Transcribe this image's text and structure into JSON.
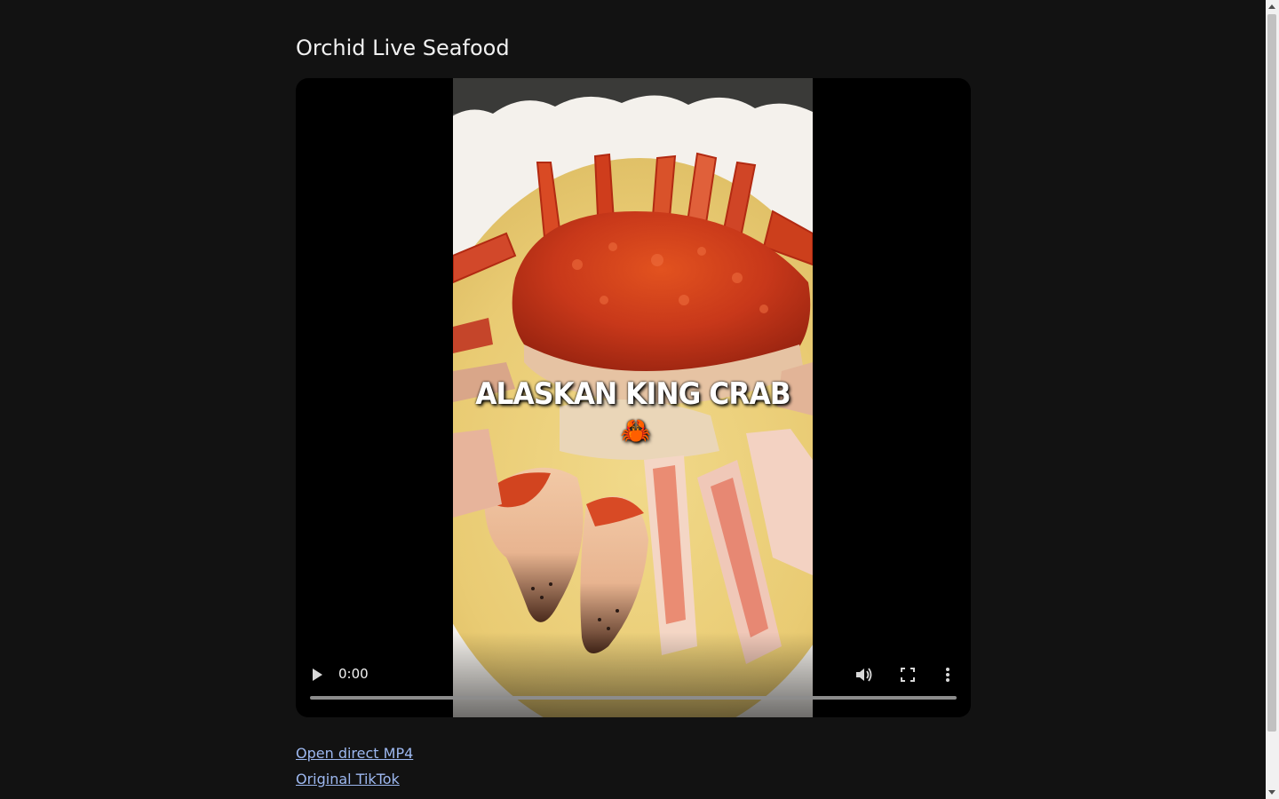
{
  "page": {
    "title": "Orchid Live Seafood"
  },
  "video": {
    "overlay_caption": "ALASKAN KING CRAB",
    "overlay_emoji": "🦀",
    "current_time": "0:00",
    "progress": 0,
    "controls": {
      "play_icon": "play-icon",
      "volume_icon": "volume-icon",
      "fullscreen_icon": "fullscreen-icon",
      "menu_icon": "more-vert-icon"
    }
  },
  "links": [
    {
      "label": "Open direct MP4"
    },
    {
      "label": "Original TikTok"
    }
  ],
  "colors": {
    "background": "#121212",
    "link": "#9db8f0",
    "player_background": "#000000"
  }
}
